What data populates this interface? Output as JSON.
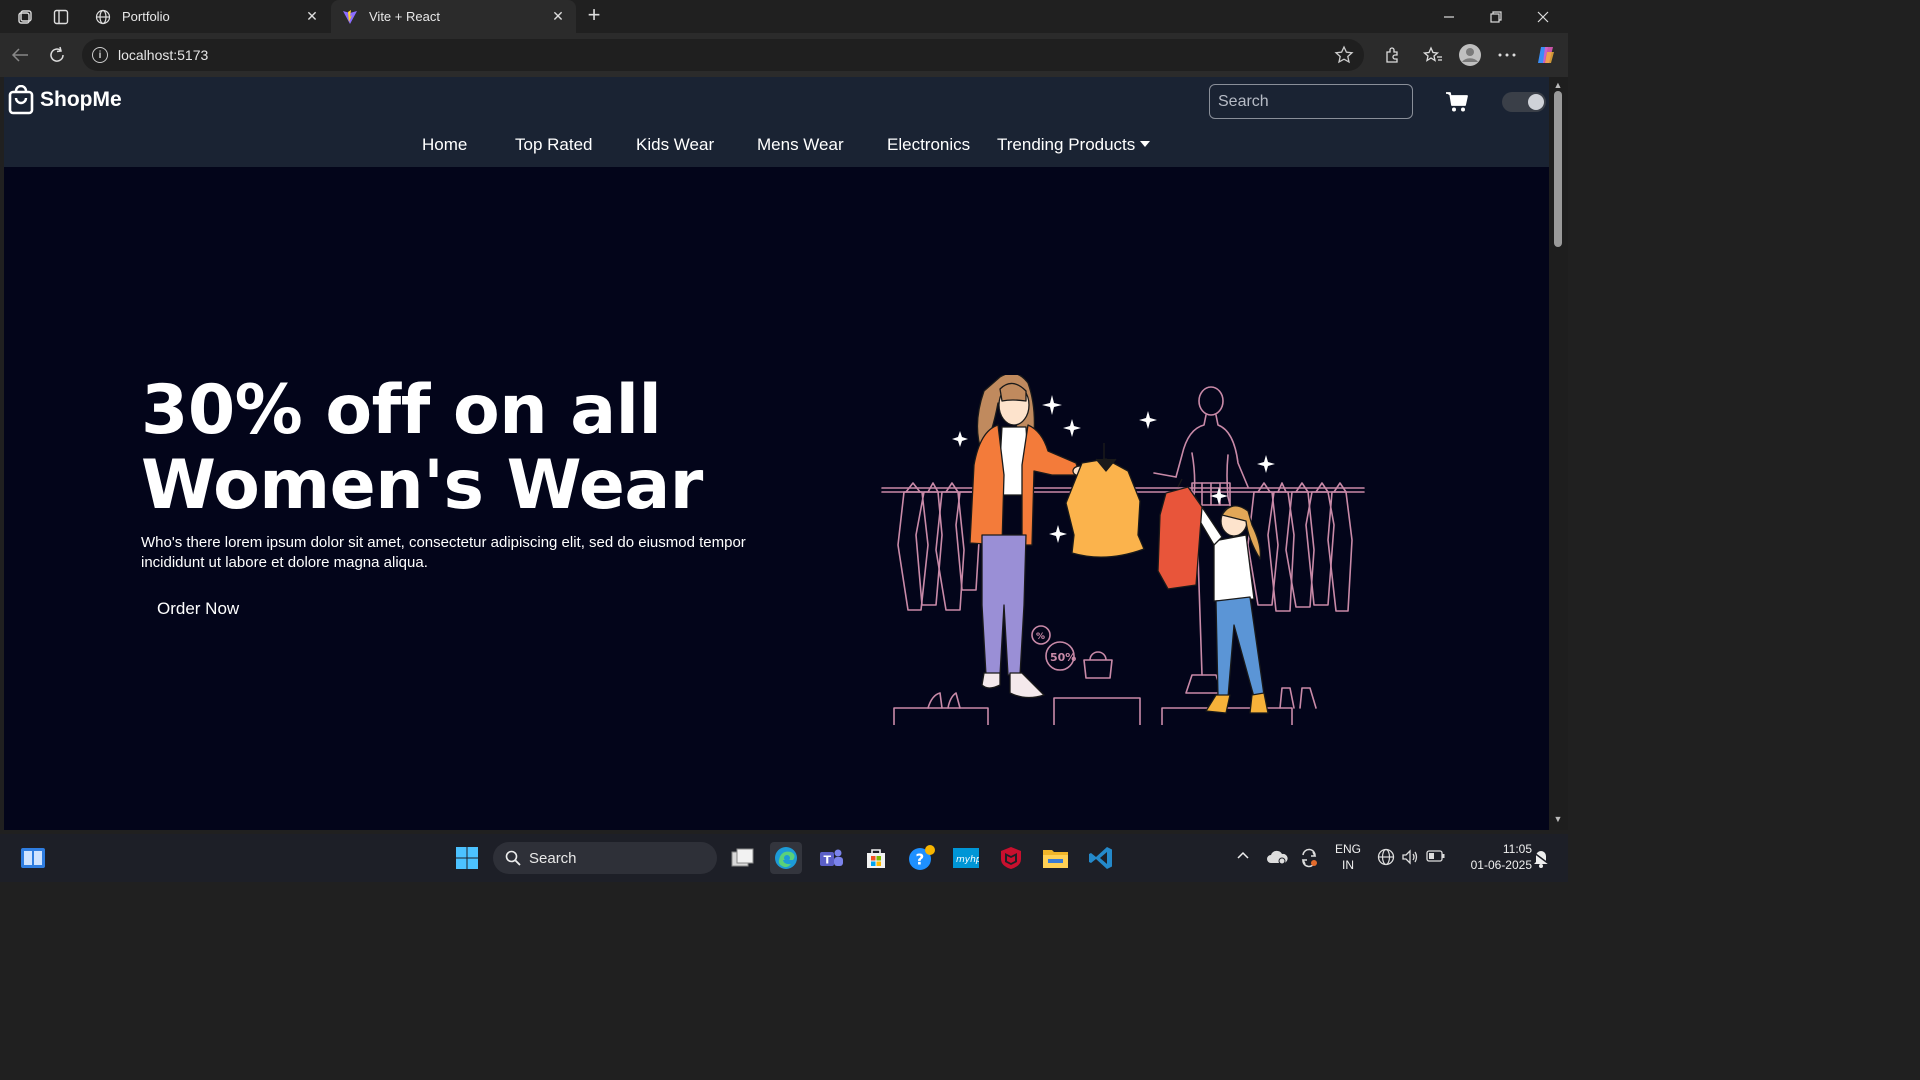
{
  "browser": {
    "tabs": [
      {
        "title": "Portfolio",
        "active": false,
        "favicon": "globe-icon"
      },
      {
        "title": "Vite + React",
        "active": true,
        "favicon": "vite-logo-icon"
      }
    ],
    "address": "localhost:5173"
  },
  "site": {
    "brand": "ShopMe",
    "search_placeholder": "Search",
    "menu": [
      {
        "label": "Home"
      },
      {
        "label": "Top Rated"
      },
      {
        "label": "Kids Wear"
      },
      {
        "label": "Mens Wear"
      },
      {
        "label": "Electronics"
      },
      {
        "label": "Trending Products",
        "has_dropdown": true
      }
    ]
  },
  "hero": {
    "title_line1": "30% off on all",
    "title_line2": "Women's Wear",
    "description": "Who's there lorem ipsum dolor sit amet, consectetur adipiscing elit, sed do eiusmod tempor incididunt ut labore et dolore magna aliqua.",
    "cta": "Order Now",
    "illustration_badges": [
      "%",
      "50%"
    ]
  },
  "taskbar": {
    "search_label": "Search",
    "language": "ENG",
    "region": "IN",
    "time": "11:05",
    "date": "01-06-2025"
  },
  "colors": {
    "page_bg": "#03051a",
    "header_bg": "#1a2333",
    "chrome_bg": "#202020",
    "toolbar_bg": "#2b2b2b",
    "taskbar_bg": "#1d1f27",
    "illus_line": "#c98aa8",
    "jacket_orange": "#f37b3a",
    "dress_yellow": "#fbb34c",
    "coat_red": "#e8553a",
    "pants_purple": "#9a8fd6",
    "jeans_blue": "#5b95d6"
  }
}
